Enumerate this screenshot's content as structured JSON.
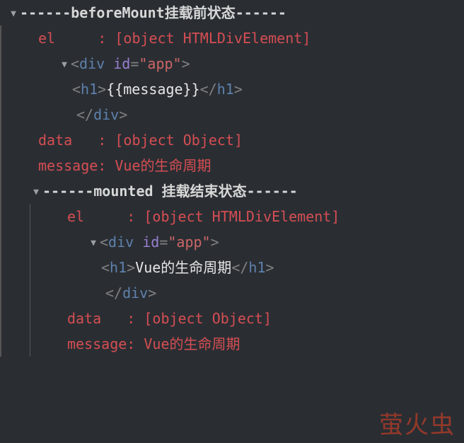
{
  "group1": {
    "arrow": "▼",
    "header_prefix": "------",
    "header_name": "beforeMount",
    "header_suffix": "挂载前状态------",
    "el_label": "el     : ",
    "el_value": "[object HTMLDivElement]",
    "dom": {
      "arrow": "▼",
      "open_lt": "<",
      "tag_div": "div",
      "space": " ",
      "attr_id": "id",
      "eq": "=",
      "q1": "\"",
      "id_val": "app",
      "q2": "\"",
      "open_gt": ">",
      "h1_open_lt": "<",
      "h1_tag": "h1",
      "h1_open_gt": ">",
      "h1_text": "{{message}}",
      "h1_close_lt": "</",
      "h1_close_tag": "h1",
      "h1_close_gt": ">",
      "div_close_lt": "</",
      "div_close_tag": "div",
      "div_close_gt": ">"
    },
    "data_label": "data   : ",
    "data_value": "[object Object]",
    "msg_label": "message: ",
    "msg_value": "Vue的生命周期"
  },
  "group2": {
    "arrow": "▼",
    "header_prefix": "------",
    "header_name": "mounted",
    "header_mid": " ",
    "header_suffix": "挂载结束状态------",
    "el_label": "el     : ",
    "el_value": "[object HTMLDivElement]",
    "dom": {
      "arrow": "▼",
      "open_lt": "<",
      "tag_div": "div",
      "space": " ",
      "attr_id": "id",
      "eq": "=",
      "q1": "\"",
      "id_val": "app",
      "q2": "\"",
      "open_gt": ">",
      "h1_open_lt": "<",
      "h1_tag": "h1",
      "h1_open_gt": ">",
      "h1_text": "Vue的生命周期",
      "h1_close_lt": "</",
      "h1_close_tag": "h1",
      "h1_close_gt": ">",
      "div_close_lt": "</",
      "div_close_tag": "div",
      "div_close_gt": ">"
    },
    "data_label": "data   : ",
    "data_value": "[object Object]",
    "msg_label": "message: ",
    "msg_value": "Vue的生命周期"
  },
  "watermark": "萤火虫"
}
